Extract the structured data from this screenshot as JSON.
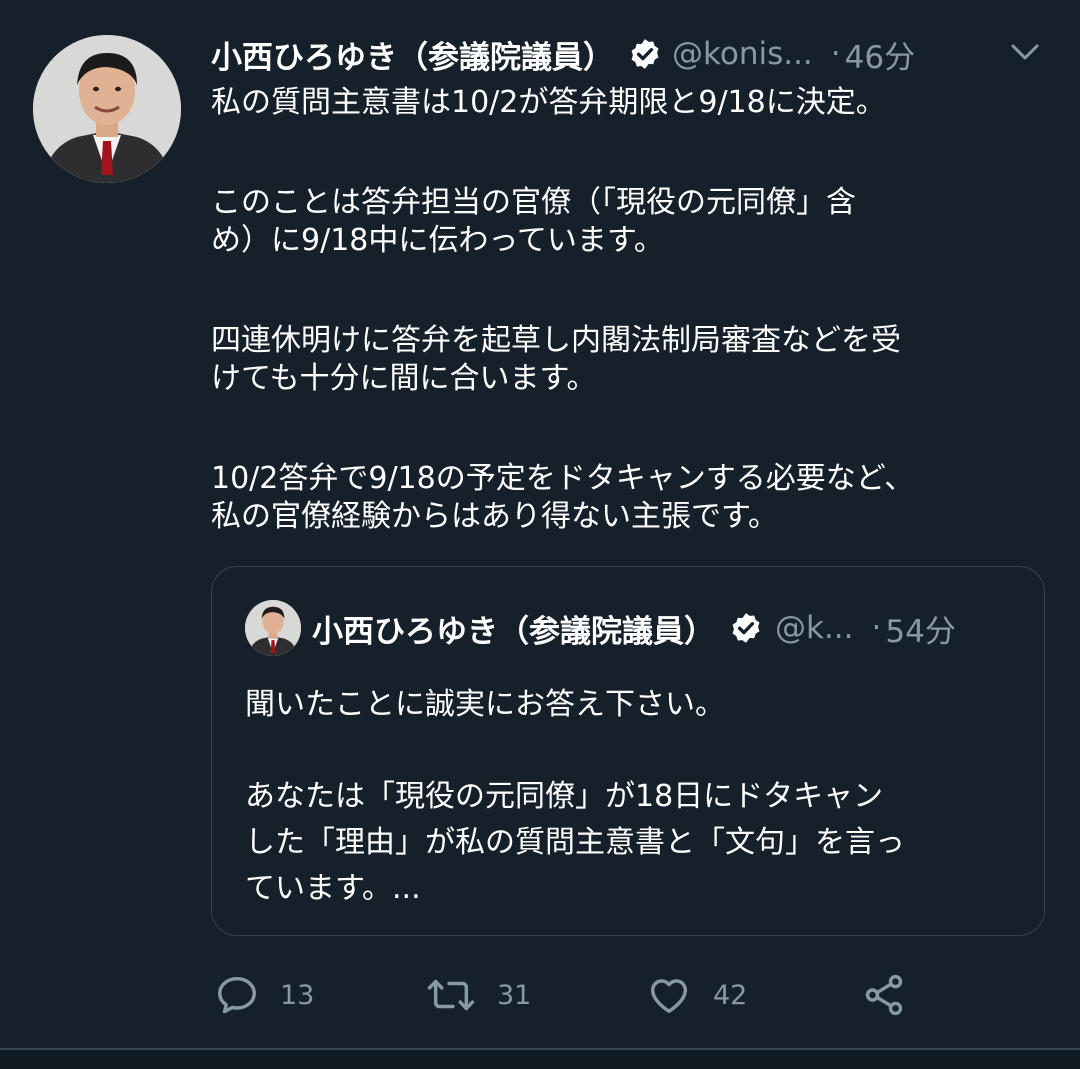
{
  "tweet": {
    "author_name": "小西ひろゆき（参議院議員）",
    "handle": "@konis...",
    "separator": "·",
    "time": "46分",
    "paragraphs": [
      "私の質問主意書は10/2が答弁期限と9/18に決定。",
      "このことは答弁担当の官僚（「現役の元同僚」含\nめ）に9/18中に伝わっています。",
      "四連休明けに答弁を起草し内閣法制局審査などを受\nけても十分に間に合います。",
      "10/2答弁で9/18の予定をドタキャンする必要など、\n私の官僚経験からはあり得ない主張です。"
    ]
  },
  "quoted_tweet": {
    "author_name": "小西ひろゆき（参議院議員）",
    "handle": "@k...",
    "separator": "·",
    "time": "54分",
    "paragraphs": [
      "聞いたことに誠実にお答え下さい。",
      "あなたは「現役の元同僚」が18日にドタキャン\nした「理由」が私の質問主意書と「文句」を言っ\nています。..."
    ]
  },
  "actions": {
    "reply_count": "13",
    "retweet_count": "31",
    "like_count": "42"
  },
  "icons": {
    "verified": "verified-badge-icon",
    "menu": "chevron-down-icon",
    "reply": "reply-icon",
    "retweet": "retweet-icon",
    "like": "heart-icon",
    "share": "share-icon"
  },
  "colors": {
    "background": "#15202b",
    "text_primary": "#ffffff",
    "text_secondary": "#8899a6",
    "border": "#38444d"
  }
}
